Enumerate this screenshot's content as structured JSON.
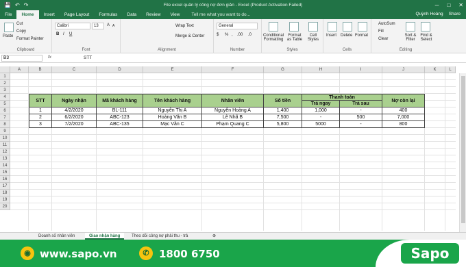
{
  "titlebar": {
    "window_title": "File excel quản lý công nợ đơn giản - Excel (Product Activation Failed)",
    "save_glyph": "💾",
    "undo_glyph": "↶",
    "redo_glyph": "↷",
    "minimize": "─",
    "restore": "□",
    "close": "✕"
  },
  "tabs": [
    {
      "label": "File"
    },
    {
      "label": "Home"
    },
    {
      "label": "Insert"
    },
    {
      "label": "Page Layout"
    },
    {
      "label": "Formulas"
    },
    {
      "label": "Data"
    },
    {
      "label": "Review"
    },
    {
      "label": "View"
    }
  ],
  "tell_me": "Tell me what you want to do...",
  "user": {
    "name": "Quỳnh Hoàng",
    "share": "Share"
  },
  "ribbon": {
    "clipboard": {
      "paste": "Paste",
      "cut": "Cut",
      "copy": "Copy",
      "format_painter": "Format Painter",
      "label": "Clipboard"
    },
    "font": {
      "name": "Calibri",
      "size": "13",
      "bold": "B",
      "italic": "I",
      "underline": "U",
      "grow": "A",
      "shrink": "A",
      "label": "Font"
    },
    "alignment": {
      "wrap": "Wrap Text",
      "merge": "Merge & Center",
      "label": "Alignment"
    },
    "number": {
      "format": "General",
      "currency": "$",
      "percent": "%",
      "comma": ",",
      "inc": ".00",
      "dec": ".0",
      "label": "Number"
    },
    "styles": {
      "cond": "Conditional Formatting",
      "table": "Format as Table",
      "cell": "Cell Styles",
      "label": "Styles"
    },
    "cells": {
      "insert": "Insert",
      "delete": "Delete",
      "format": "Format",
      "label": "Cells"
    },
    "editing": {
      "autosum": "AutoSum",
      "fill": "Fill",
      "clear": "Clear",
      "sort": "Sort & Filter",
      "find": "Find & Select",
      "label": "Editing"
    }
  },
  "formula_bar": {
    "name_box": "B3",
    "fx": "fx",
    "value": "STT"
  },
  "columns": [
    "A",
    "B",
    "C",
    "D",
    "E",
    "F",
    "G",
    "H",
    "I",
    "J",
    "K",
    "L"
  ],
  "rows": [
    "1",
    "2",
    "3",
    "4",
    "5",
    "6",
    "7",
    "8",
    "9",
    "10",
    "11",
    "12",
    "13",
    "14",
    "15",
    "16",
    "17",
    "18",
    "19",
    "20"
  ],
  "table": {
    "headers": {
      "stt": "STT",
      "ngay_nhan": "Ngày nhận",
      "ma_kh": "Mã khách hàng",
      "ten_kh": "Tên khách hàng",
      "nhan_vien": "Nhân viên",
      "so_tien": "Số tiền",
      "thanh_toan": "Thanh toán",
      "tra_ngay": "Trả ngay",
      "tra_sau": "Trả sau",
      "no_con_lai": "Nợ còn lại"
    },
    "rows": [
      {
        "stt": "1",
        "ngay": "4/2/2020",
        "ma": "BL-111",
        "ten": "Nguyễn Thị A",
        "nv": "Nguyễn Hoàng A",
        "tien": "1,400",
        "tra_ngay": "1,000",
        "tra_sau": "-",
        "no": "400"
      },
      {
        "stt": "2",
        "ngay": "6/2/2020",
        "ma": "ABC-123",
        "ten": "Hoàng Văn B",
        "nv": "Lê Nhã B",
        "tien": "7,500",
        "tra_ngay": "-",
        "tra_sau": "500",
        "no": "7,000"
      },
      {
        "stt": "3",
        "ngay": "7/2/2020",
        "ma": "ABC-135",
        "ten": "Mạc Văn C",
        "nv": "Phạm Quang C",
        "tien": "5,800",
        "tra_ngay": "5000",
        "tra_sau": "-",
        "no": "800"
      }
    ]
  },
  "sheets": [
    {
      "label": "Doanh số nhân viên"
    },
    {
      "label": "Giao nhận hàng"
    },
    {
      "label": "Theo dõi công nợ phải thu - trả"
    }
  ],
  "add_sheet": "⊕",
  "banner": {
    "website": "www.sapo.vn",
    "phone": "1800 6750",
    "brand": "Sapo",
    "globe_icon_glyph": "◉",
    "phone_icon_glyph": "✆",
    "brand_color": "#1aa54a"
  }
}
